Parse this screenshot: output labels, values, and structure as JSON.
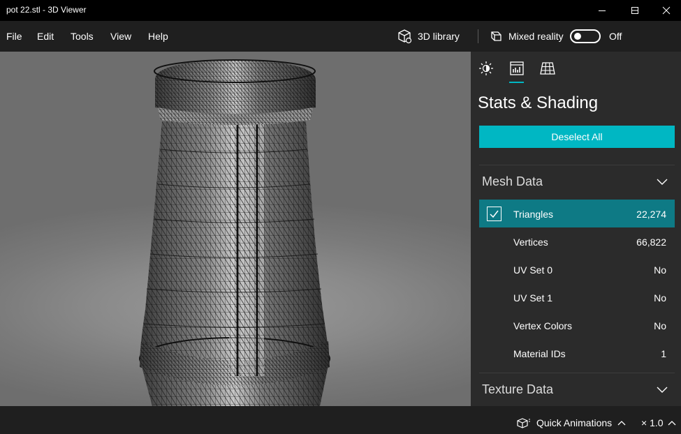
{
  "window": {
    "title": "pot 22.stl - 3D Viewer"
  },
  "menu": {
    "items": [
      "File",
      "Edit",
      "Tools",
      "View",
      "Help"
    ]
  },
  "toolbar": {
    "library_label": "3D library",
    "mixed_reality_label": "Mixed reality",
    "mixed_reality_state": "Off",
    "mixed_reality_on": false
  },
  "panel": {
    "title": "Stats & Shading",
    "deselect_label": "Deselect All",
    "mesh_section": "Mesh Data",
    "texture_section": "Texture Data",
    "mesh_rows": [
      {
        "name": "Triangles",
        "value": "22,274",
        "selected": true
      },
      {
        "name": "Vertices",
        "value": "66,822"
      },
      {
        "name": "UV Set 0",
        "value": "No"
      },
      {
        "name": "UV Set 1",
        "value": "No"
      },
      {
        "name": "Vertex Colors",
        "value": "No"
      },
      {
        "name": "Material IDs",
        "value": "1"
      }
    ]
  },
  "statusbar": {
    "quick_animations_label": "Quick Animations",
    "speed_label": "× 1.0"
  },
  "colors": {
    "accent": "#00b7c3",
    "selected_row": "#0e7a85",
    "panel_bg": "#2b2b2b",
    "chrome_bg": "#1f1f1f"
  }
}
